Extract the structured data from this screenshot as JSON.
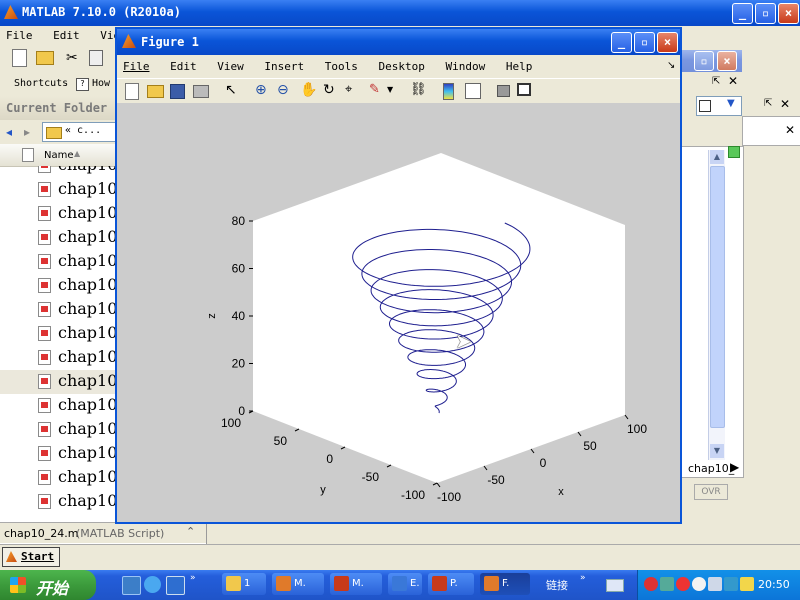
{
  "matlab": {
    "title": "MATLAB  7.10.0  (R2010a)",
    "menu": [
      "File",
      "Edit",
      "View"
    ],
    "shortcuts_label": "Shortcuts",
    "howto_label": "How",
    "current_folder_title": "Current Folder",
    "path_text": "« c...",
    "name_header": "Name",
    "files": [
      "chap10_",
      "chap10_",
      "chap10_",
      "chap10_",
      "chap10_",
      "chap10_",
      "chap10_",
      "chap10_",
      "chap10_",
      "chap10_",
      "chap10_",
      "chap10_",
      "chap10_",
      "chap10_",
      "chap10_"
    ],
    "selected_file_index": 9,
    "details_file": "chap10_24.m",
    "details_type": "(MATLAB Script)",
    "start_button": "Start",
    "ovr_label": "OVR",
    "right_list_item": "chap10_"
  },
  "figure": {
    "title": "Figure 1",
    "menu": [
      "File",
      "Edit",
      "View",
      "Insert",
      "Tools",
      "Desktop",
      "Window",
      "Help"
    ]
  },
  "chart_data": {
    "type": "line3d",
    "title": "",
    "xlabel": "x",
    "ylabel": "y",
    "zlabel": "z",
    "xlim": [
      -100,
      100
    ],
    "ylim": [
      -100,
      100
    ],
    "zlim": [
      0,
      80
    ],
    "xticks": [
      "-100",
      "-50",
      "0",
      "50",
      "100"
    ],
    "yticks": [
      "-100",
      "-50",
      "0",
      "50",
      "100"
    ],
    "zticks": [
      "0",
      "20",
      "40",
      "60",
      "80"
    ],
    "series_color": "#1f1f8f",
    "description": "conical helix: radius grows with z",
    "turns": 10,
    "z_range": [
      0,
      70
    ],
    "max_radius": 70
  },
  "taskbar": {
    "start_label": "开始",
    "buttons": [
      "1",
      "M.",
      "M.",
      "E.",
      "P.",
      "F."
    ],
    "links_label": "链接",
    "clock": "20:50"
  },
  "colors": {
    "xp_blue": "#0a55d8",
    "taskbar": "#245edb",
    "start_green": "#3c9b3c",
    "plot_bg": "#ffffff",
    "figure_bg": "#cccccc"
  }
}
